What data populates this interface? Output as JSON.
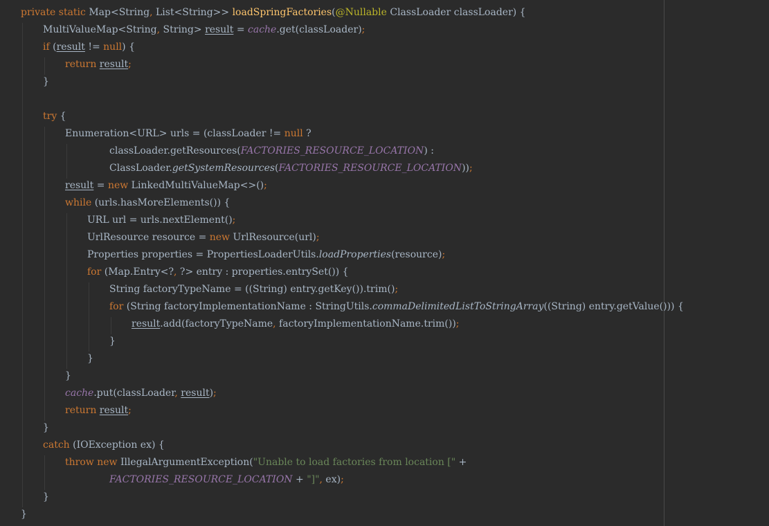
{
  "editor": {
    "theme": "Darcula",
    "colors": {
      "background": "#2b2b2b",
      "default_text": "#a9b7c6",
      "keyword": "#cc7832",
      "method_declaration": "#ffc66d",
      "annotation": "#bbb529",
      "string": "#6a8759",
      "constant_field": "#9876aa",
      "right_margin": "#4a4a4a"
    },
    "lines": [
      [
        {
          "t": "private",
          "c": "kw"
        },
        {
          "t": " "
        },
        {
          "t": "static",
          "c": "kw"
        },
        {
          "t": " Map<String"
        },
        {
          "t": ",",
          "c": "punct"
        },
        {
          "t": " List<String>> "
        },
        {
          "t": "loadSpringFactories",
          "c": "fn"
        },
        {
          "t": "("
        },
        {
          "t": "@Nullable",
          "c": "ann"
        },
        {
          "t": " ClassLoader classLoader) {"
        }
      ],
      [
        {
          "t": "MultiValueMap<String"
        },
        {
          "t": ",",
          "c": "punct"
        },
        {
          "t": " String> "
        },
        {
          "t": "result",
          "c": "var-ul"
        },
        {
          "t": " = "
        },
        {
          "t": "cache",
          "c": "static-field"
        },
        {
          "t": ".get(classLoader)"
        },
        {
          "t": ";",
          "c": "punct"
        }
      ],
      [
        {
          "t": "if",
          "c": "kw"
        },
        {
          "t": " ("
        },
        {
          "t": "result",
          "c": "var-ul"
        },
        {
          "t": " != "
        },
        {
          "t": "null",
          "c": "kw"
        },
        {
          "t": ") {"
        }
      ],
      [
        {
          "t": "return",
          "c": "kw"
        },
        {
          "t": " "
        },
        {
          "t": "result",
          "c": "var-ul"
        },
        {
          "t": ";",
          "c": "punct"
        }
      ],
      [
        {
          "t": "}"
        }
      ],
      [],
      [
        {
          "t": "try",
          "c": "kw"
        },
        {
          "t": " {"
        }
      ],
      [
        {
          "t": "Enumeration<URL> urls = (classLoader != "
        },
        {
          "t": "null",
          "c": "kw"
        },
        {
          "t": " ?"
        }
      ],
      [
        {
          "t": "classLoader.getResources("
        },
        {
          "t": "FACTORIES_RESOURCE_LOCATION",
          "c": "const"
        },
        {
          "t": ") :"
        }
      ],
      [
        {
          "t": "ClassLoader."
        },
        {
          "t": "getSystemResources",
          "c": "static-call"
        },
        {
          "t": "("
        },
        {
          "t": "FACTORIES_RESOURCE_LOCATION",
          "c": "const"
        },
        {
          "t": "))"
        },
        {
          "t": ";",
          "c": "punct"
        }
      ],
      [
        {
          "t": "result",
          "c": "var-ul"
        },
        {
          "t": " = "
        },
        {
          "t": "new",
          "c": "kw"
        },
        {
          "t": " LinkedMultiValueMap<>()"
        },
        {
          "t": ";",
          "c": "punct"
        }
      ],
      [
        {
          "t": "while",
          "c": "kw"
        },
        {
          "t": " (urls.hasMoreElements()) {"
        }
      ],
      [
        {
          "t": "URL url = urls.nextElement()"
        },
        {
          "t": ";",
          "c": "punct"
        }
      ],
      [
        {
          "t": "UrlResource resource = "
        },
        {
          "t": "new",
          "c": "kw"
        },
        {
          "t": " UrlResource(url)"
        },
        {
          "t": ";",
          "c": "punct"
        }
      ],
      [
        {
          "t": "Properties properties = PropertiesLoaderUtils."
        },
        {
          "t": "loadProperties",
          "c": "static-call"
        },
        {
          "t": "(resource)"
        },
        {
          "t": ";",
          "c": "punct"
        }
      ],
      [
        {
          "t": "for",
          "c": "kw"
        },
        {
          "t": " (Map.Entry<?"
        },
        {
          "t": ",",
          "c": "punct"
        },
        {
          "t": " ?> entry : properties.entrySet()) {"
        }
      ],
      [
        {
          "t": "String factoryTypeName = ((String) entry.getKey()).trim()"
        },
        {
          "t": ";",
          "c": "punct"
        }
      ],
      [
        {
          "t": "for",
          "c": "kw"
        },
        {
          "t": " (String factoryImplementationName : StringUtils."
        },
        {
          "t": "commaDelimitedListToStringArray",
          "c": "static-call"
        },
        {
          "t": "((String) entry.getValue())) {"
        }
      ],
      [
        {
          "t": "result",
          "c": "var-ul"
        },
        {
          "t": ".add(factoryTypeName"
        },
        {
          "t": ",",
          "c": "punct"
        },
        {
          "t": " factoryImplementationName.trim())"
        },
        {
          "t": ";",
          "c": "punct"
        }
      ],
      [
        {
          "t": "}"
        }
      ],
      [
        {
          "t": "}"
        }
      ],
      [
        {
          "t": "}"
        }
      ],
      [
        {
          "t": "cache",
          "c": "static-field"
        },
        {
          "t": ".put(classLoader"
        },
        {
          "t": ",",
          "c": "punct"
        },
        {
          "t": " "
        },
        {
          "t": "result",
          "c": "var-ul"
        },
        {
          "t": ")"
        },
        {
          "t": ";",
          "c": "punct"
        }
      ],
      [
        {
          "t": "return",
          "c": "kw"
        },
        {
          "t": " "
        },
        {
          "t": "result",
          "c": "var-ul"
        },
        {
          "t": ";",
          "c": "punct"
        }
      ],
      [
        {
          "t": "}"
        }
      ],
      [
        {
          "t": "catch",
          "c": "kw"
        },
        {
          "t": " (IOException ex) {"
        }
      ],
      [
        {
          "t": "throw",
          "c": "kw"
        },
        {
          "t": " "
        },
        {
          "t": "new",
          "c": "kw"
        },
        {
          "t": " IllegalArgumentException("
        },
        {
          "t": "\"Unable to load factories from location [\"",
          "c": "str"
        },
        {
          "t": " +"
        }
      ],
      [
        {
          "t": "FACTORIES_RESOURCE_LOCATION",
          "c": "const"
        },
        {
          "t": " + "
        },
        {
          "t": "\"]\"",
          "c": "str"
        },
        {
          "t": ",",
          "c": "punct"
        },
        {
          "t": " ex)"
        },
        {
          "t": ";",
          "c": "punct"
        }
      ],
      [
        {
          "t": "}"
        }
      ],
      [
        {
          "t": "}"
        }
      ]
    ]
  }
}
